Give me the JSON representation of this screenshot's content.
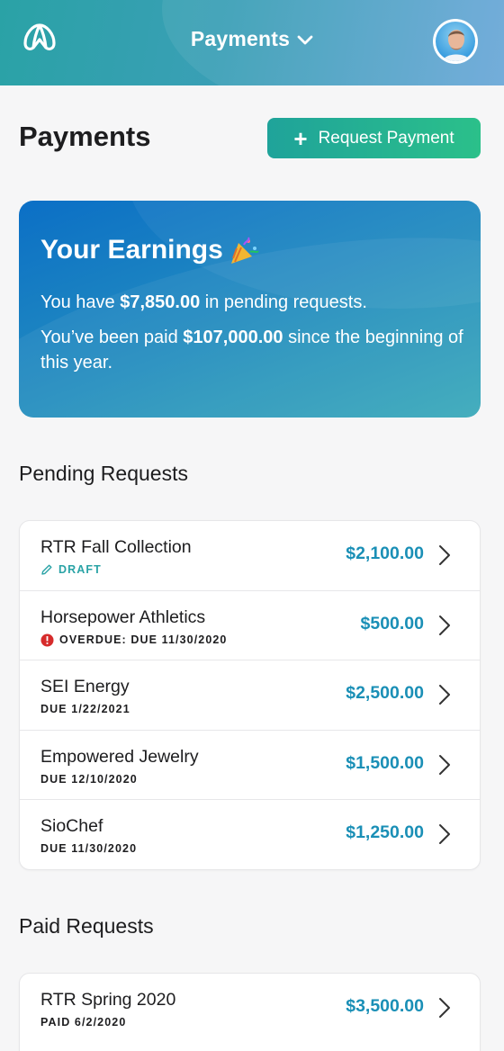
{
  "header": {
    "title": "Payments"
  },
  "page": {
    "title": "Payments",
    "request_button": "Request Payment"
  },
  "earnings": {
    "title": "Your Earnings",
    "line1_pre": "You have ",
    "line1_amount": "$7,850.00",
    "line1_post": " in pending requests.",
    "line2_pre": "You’ve been paid ",
    "line2_amount": "$107,000.00",
    "line2_post": " since the beginning of this year."
  },
  "pending": {
    "title": "Pending Requests",
    "items": [
      {
        "name": "RTR Fall Collection",
        "status": "DRAFT",
        "amount": "$2,100.00"
      },
      {
        "name": "Horsepower Athletics",
        "status": "OVERDUE: DUE 11/30/2020",
        "amount": "$500.00"
      },
      {
        "name": "SEI Energy",
        "status": "DUE 1/22/2021",
        "amount": "$2,500.00"
      },
      {
        "name": "Empowered Jewelry",
        "status": "DUE 12/10/2020",
        "amount": "$1,500.00"
      },
      {
        "name": "SioChef",
        "status": "DUE 11/30/2020",
        "amount": "$1,250.00"
      }
    ]
  },
  "paid": {
    "title": "Paid Requests",
    "items": [
      {
        "name": "RTR Spring 2020",
        "status": "PAID 6/2/2020",
        "amount": "$3,500.00"
      }
    ]
  },
  "colors": {
    "accent_teal": "#2aa3a6",
    "amount_blue": "#1a8fb6",
    "overdue_red": "#d62b2b"
  },
  "icons": [
    "logo-icon",
    "chevron-down-icon",
    "avatar",
    "plus-icon",
    "party-popper-icon",
    "pencil-icon",
    "alert-icon",
    "chevron-right-icon"
  ]
}
